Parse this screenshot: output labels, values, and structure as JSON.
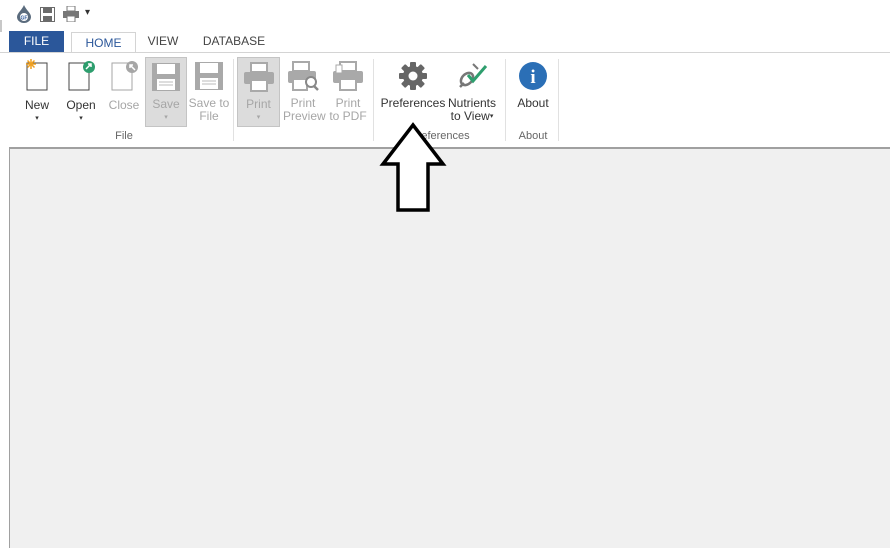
{
  "colors": {
    "accent": "#2b579a",
    "disabled": "#a6a6a6",
    "content_bg": "#f0f0f0"
  },
  "qat": {
    "items": [
      {
        "name": "app-logo-icon",
        "text": "GF"
      },
      {
        "name": "save-icon"
      },
      {
        "name": "print-icon"
      },
      {
        "name": "customize-dropdown-icon",
        "glyph": "▾"
      }
    ]
  },
  "tabs": {
    "file": "FILE",
    "home": "HOME",
    "view": "VIEW",
    "database": "DATABASE"
  },
  "ribbon": {
    "new": {
      "label": "New",
      "arrow": "▾"
    },
    "open": {
      "label": "Open",
      "arrow": "▾"
    },
    "close": {
      "label": "Close"
    },
    "save": {
      "label": "Save",
      "arrow": "▾"
    },
    "save_to_file": {
      "label_line1": "Save to",
      "label_line2": "File"
    },
    "print": {
      "label": "Print",
      "arrow": "▾"
    },
    "print_preview": {
      "label_line1": "Print",
      "label_line2": "Preview"
    },
    "print_to_pdf": {
      "label_line1": "Print",
      "label_line2": "to PDF"
    },
    "preferences": {
      "label": "Preferences"
    },
    "nutrients_to_view": {
      "label_line1": "Nutrients",
      "label_line2": "to View",
      "arrow": "▾"
    },
    "about": {
      "label": "About",
      "icon_text": "i"
    },
    "groups": {
      "file": "File",
      "preferences": "Preferences",
      "about": "About"
    }
  }
}
